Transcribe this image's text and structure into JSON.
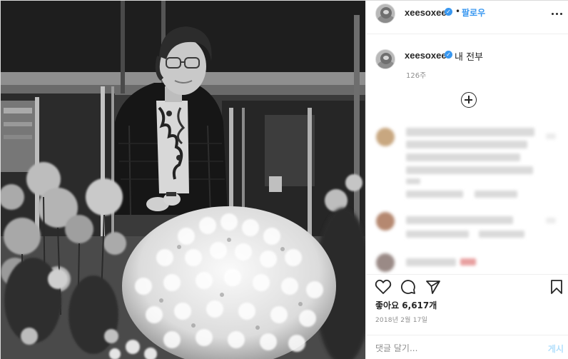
{
  "photo": {
    "description_icon": "black-and-white-photo-elderly-woman-with-chrysanthemums"
  },
  "header": {
    "username": "xeesoxee",
    "separator": "•",
    "follow_label": "팔로우",
    "more_icon": "more-options-icon"
  },
  "caption": {
    "username": "xeesoxee",
    "text": "내 전부",
    "time_ago": "126주"
  },
  "comments": {
    "load_more_icon": "plus-circle-icon"
  },
  "actions": {
    "like_icon": "heart-icon",
    "comment_icon": "comment-bubble-icon",
    "share_icon": "paper-plane-icon",
    "save_icon": "bookmark-icon",
    "likes_text": "좋아요 6,617개",
    "date_text": "2018년 2월 17일"
  },
  "comment_bar": {
    "placeholder": "댓글 달기...",
    "post_label": "게시"
  },
  "colors": {
    "accent": "#3897f0",
    "verified": "#3897f0",
    "muted": "#8e8e8e",
    "post_disabled": "#b2dffc"
  }
}
